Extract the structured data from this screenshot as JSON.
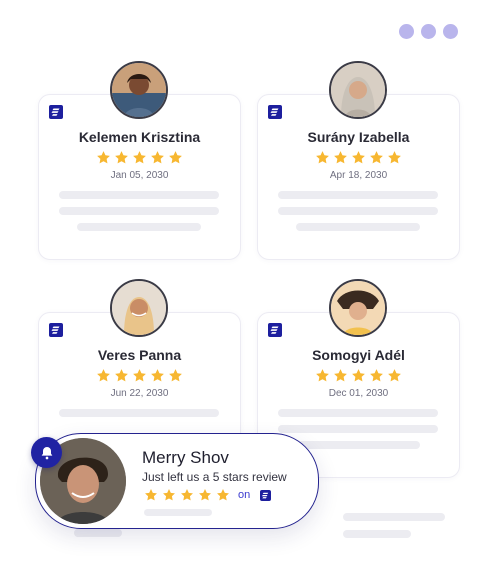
{
  "header": {
    "dots_color": "#b9b5ec"
  },
  "colors": {
    "star": "#f7b731",
    "brand": "#1d1f9e",
    "toast_border": "#24238f"
  },
  "reviews": [
    {
      "name": "Kelemen Krisztina",
      "date": "Jan 05, 2030",
      "rating": 5
    },
    {
      "name": "Surány Izabella",
      "date": "Apr 18, 2030",
      "rating": 5
    },
    {
      "name": "Veres Panna",
      "date": "Jun 22, 2030",
      "rating": 5
    },
    {
      "name": "Somogyi Adél",
      "date": "Dec 01, 2030",
      "rating": 5
    }
  ],
  "notification": {
    "name": "Merry Shov",
    "message": "Just left us a 5 stars review",
    "rating": 5,
    "on_label": "on",
    "icon": "bell-icon"
  }
}
